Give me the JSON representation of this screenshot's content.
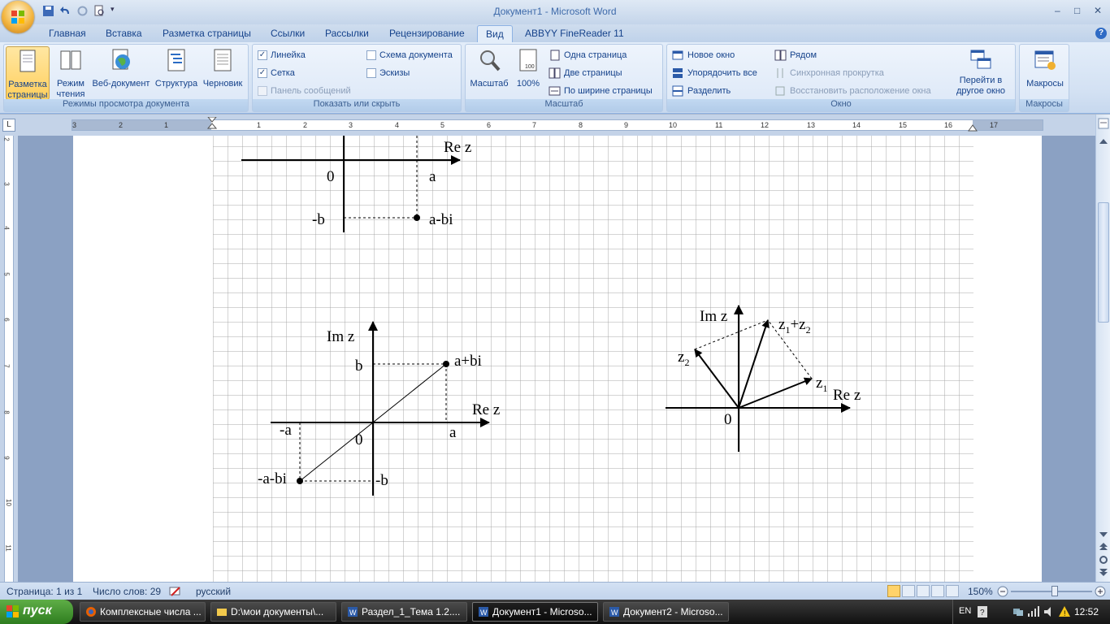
{
  "window": {
    "title": "Документ1 - Microsoft Word",
    "controls": {
      "minimize": "–",
      "maximize": "□",
      "close": "✕"
    }
  },
  "quick_access": [
    "save-icon",
    "undo-icon",
    "redo-icon",
    "print-preview-icon"
  ],
  "tabs": [
    {
      "label": "Главная"
    },
    {
      "label": "Вставка"
    },
    {
      "label": "Разметка страницы"
    },
    {
      "label": "Ссылки"
    },
    {
      "label": "Рассылки"
    },
    {
      "label": "Рецензирование"
    },
    {
      "label": "Вид",
      "active": true
    },
    {
      "label": "ABBYY FineReader 11"
    }
  ],
  "ribbon": {
    "views": {
      "label": "Режимы просмотра документа",
      "buttons": [
        {
          "line1": "Разметка",
          "line2": "страницы",
          "selected": true
        },
        {
          "line1": "Режим",
          "line2": "чтения"
        },
        {
          "line1": "Веб-документ",
          "line2": ""
        },
        {
          "line1": "Структура",
          "line2": ""
        },
        {
          "line1": "Черновик",
          "line2": ""
        }
      ]
    },
    "show_hide": {
      "label": "Показать или скрыть",
      "items": [
        {
          "label": "Линейка",
          "checked": true,
          "enabled": true
        },
        {
          "label": "Сетка",
          "checked": true,
          "enabled": true
        },
        {
          "label": "Панель сообщений",
          "checked": false,
          "enabled": false
        },
        {
          "label": "Схема документа",
          "checked": false,
          "enabled": true
        },
        {
          "label": "Эскизы",
          "checked": false,
          "enabled": true
        }
      ]
    },
    "zoom": {
      "label": "Масштаб",
      "zoom_btn": "Масштаб",
      "percent_btn": "100%",
      "items": [
        "Одна страница",
        "Две страницы",
        "По ширине страницы"
      ]
    },
    "window_group": {
      "label": "Окно",
      "items": [
        "Новое окно",
        "Упорядочить все",
        "Разделить"
      ],
      "items2": [
        "Рядом",
        "Синхронная прокрутка",
        "Восстановить расположение окна"
      ],
      "switch_line1": "Перейти в",
      "switch_line2": "другое окно"
    },
    "macros": {
      "label": "Макросы",
      "btn": "Макросы"
    }
  },
  "ruler": {
    "numbers": [
      "3",
      "2",
      "1",
      "1",
      "2",
      "3",
      "4",
      "5",
      "6",
      "7",
      "8",
      "9",
      "10",
      "11",
      "12",
      "13",
      "14",
      "15",
      "16",
      "17"
    ],
    "vnumbers": [
      "2",
      "3",
      "4",
      "5",
      "6",
      "7",
      "8",
      "9",
      "10",
      "11"
    ]
  },
  "document": {
    "diagram1": {
      "axis_label": "Re z",
      "origin": "0",
      "a": "a",
      "minus_b": "-b",
      "point": "a-bi"
    },
    "diagram2": {
      "im_label": "Im z",
      "re_label": "Re z",
      "b": "b",
      "point1": "a+bi",
      "minus_a": "-a",
      "origin": "0",
      "a": "a",
      "point2": "-a-bi",
      "minus_b": "-b"
    },
    "diagram3": {
      "im_label": "Im z",
      "re_label": "Re z",
      "origin": "0",
      "z1": "z",
      "z1_sub": "1",
      "z2": "z",
      "z2_sub": "2",
      "sum_a": "z",
      "sum_a_sub": "1",
      "sum_plus": "+z",
      "sum_b_sub": "2"
    }
  },
  "status": {
    "page": "Страница: 1 из 1",
    "words": "Число слов: 29",
    "lang": "русский",
    "zoom": "150%"
  },
  "taskbar": {
    "start": "пуск",
    "tasks": [
      {
        "label": "Комплексные числа ...",
        "active": false
      },
      {
        "label": "D:\\мои документы\\...",
        "active": false
      },
      {
        "label": "Раздел_1_Тема 1.2....",
        "active": false
      },
      {
        "label": "Документ1 - Microso...",
        "active": true
      },
      {
        "label": "Документ2 - Microso...",
        "active": false
      }
    ],
    "lang": "EN",
    "clock": "12:52"
  }
}
